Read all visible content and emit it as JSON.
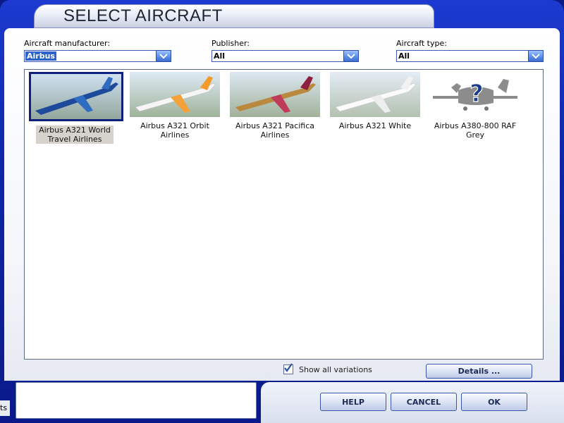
{
  "window": {
    "title": "SELECT AIRCRAFT"
  },
  "filters": {
    "manufacturer": {
      "label": "Aircraft manufacturer:",
      "value": "Airbus"
    },
    "publisher": {
      "label": "Publisher:",
      "value": "All"
    },
    "type": {
      "label": "Aircraft type:",
      "value": "All"
    }
  },
  "aircraft": [
    {
      "name": "Airbus A321 World Travel Airlines",
      "selected": true,
      "livery": "blue"
    },
    {
      "name": "Airbus A321 Orbit Airlines",
      "selected": false,
      "livery": "orange"
    },
    {
      "name": "Airbus A321 Pacifica Airlines",
      "selected": false,
      "livery": "gold"
    },
    {
      "name": "Airbus A321 White",
      "selected": false,
      "livery": "white"
    },
    {
      "name": "Airbus A380-800 RAF Grey",
      "selected": false,
      "livery": "unknown"
    }
  ],
  "options": {
    "show_all_variations": {
      "label": "Show all variations",
      "checked": true
    }
  },
  "buttons": {
    "details": "Details ...",
    "help": "HELP",
    "cancel": "CANCEL",
    "ok": "OK"
  },
  "taskbar_fragment": "ts",
  "icons": [
    "chevron-down-icon",
    "checkmark-icon",
    "question-mark-icon",
    "airplane-icon"
  ],
  "colors": {
    "frame": "#1230b8",
    "accent": "#3c6fd0",
    "selection": "#0e1f7c"
  }
}
